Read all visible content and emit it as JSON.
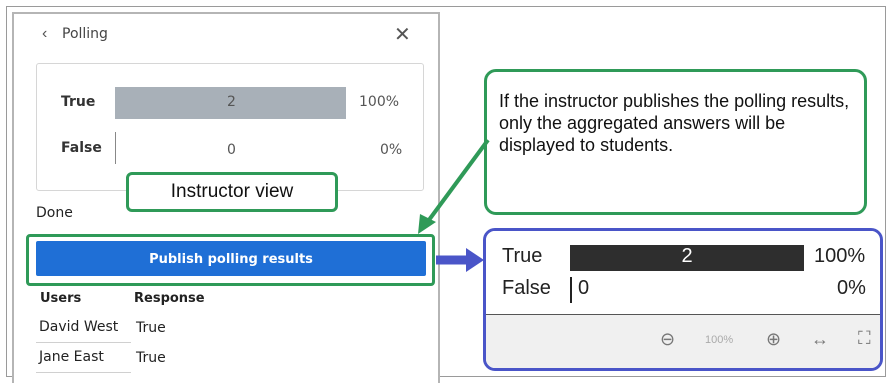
{
  "panel": {
    "back_icon": "chevron-left-icon",
    "title": "Polling",
    "close_icon": "close-icon",
    "results": [
      {
        "label": "True",
        "count": "2",
        "percent": "100%",
        "fraction": 1.0
      },
      {
        "label": "False",
        "count": "0",
        "percent": "0%",
        "fraction": 0.0
      }
    ],
    "status": "Done",
    "publish_label": "Publish polling results",
    "table": {
      "headers": [
        "Users",
        "Response"
      ],
      "rows": [
        {
          "user": "David West",
          "response": "True"
        },
        {
          "user": "Jane East",
          "response": "True"
        }
      ]
    }
  },
  "callouts": {
    "instructor_view": "Instructor view",
    "info": "If the instructor publishes the polling results, only the aggregated answers will be displayed to students."
  },
  "student_view": {
    "results": [
      {
        "label": "True",
        "count": "2",
        "percent": "100%",
        "fraction": 1.0
      },
      {
        "label": "False",
        "count": "0",
        "percent": "0%",
        "fraction": 0.0
      }
    ],
    "zoom_level": "100%",
    "controls": [
      "zoom-out-icon",
      "zoom-in-icon",
      "fit-width-icon",
      "fullscreen-icon"
    ]
  },
  "colors": {
    "callout_green": "#2f9a58",
    "student_frame_blue": "#4a55c8",
    "publish_button": "#1f6fd6",
    "instructor_bar": "#a8b0b8",
    "student_bar": "#2e2e2e"
  }
}
